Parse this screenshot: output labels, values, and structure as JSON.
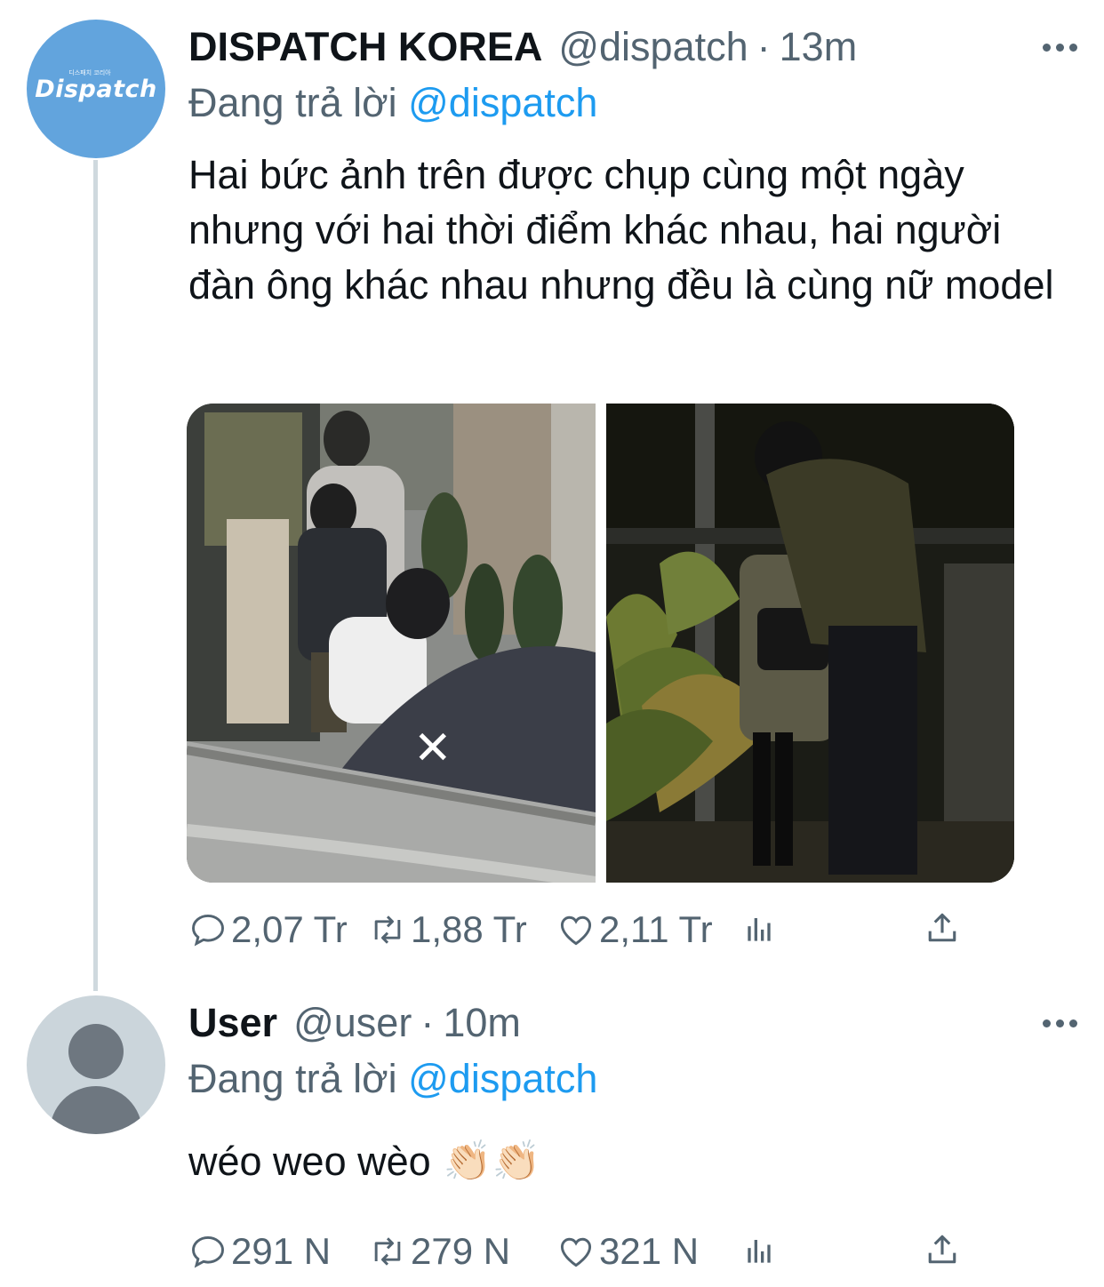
{
  "tweets": [
    {
      "name": "DISPATCH KOREA",
      "handle": "@dispatch",
      "separator": "·",
      "time": "13m",
      "replying_prefix": "Đang trả lời",
      "replying_to": "@dispatch",
      "text": "Hai bức ảnh trên được chụp cùng một ngày nhưng với hai thời điểm khác nhau, hai người đàn ông khác nhau nhưng đều là cùng nữ model",
      "avatar_logo": "Dispatch",
      "avatar_logo_small": "디스패치 코리아",
      "stats": {
        "replies": "2,07 Tr",
        "retweets": "1,88 Tr",
        "likes": "2,11 Tr"
      }
    },
    {
      "name": "User",
      "handle": "@user",
      "separator": "·",
      "time": "10m",
      "replying_prefix": "Đang trả lời",
      "replying_to": "@dispatch",
      "text": "wéo weo wèo",
      "emoji": "👏🏻👏🏻",
      "stats": {
        "replies": "291 N",
        "retweets": "279 N",
        "likes": "321 N"
      }
    }
  ],
  "icons": [
    "reply-icon",
    "retweet-icon",
    "like-icon",
    "analytics-icon",
    "share-icon",
    "more-icon"
  ],
  "colors": {
    "link": "#1d9bf0",
    "secondary": "#536471",
    "thread_line": "#cfd9de",
    "dispatch_avatar": "#62a4dd"
  }
}
